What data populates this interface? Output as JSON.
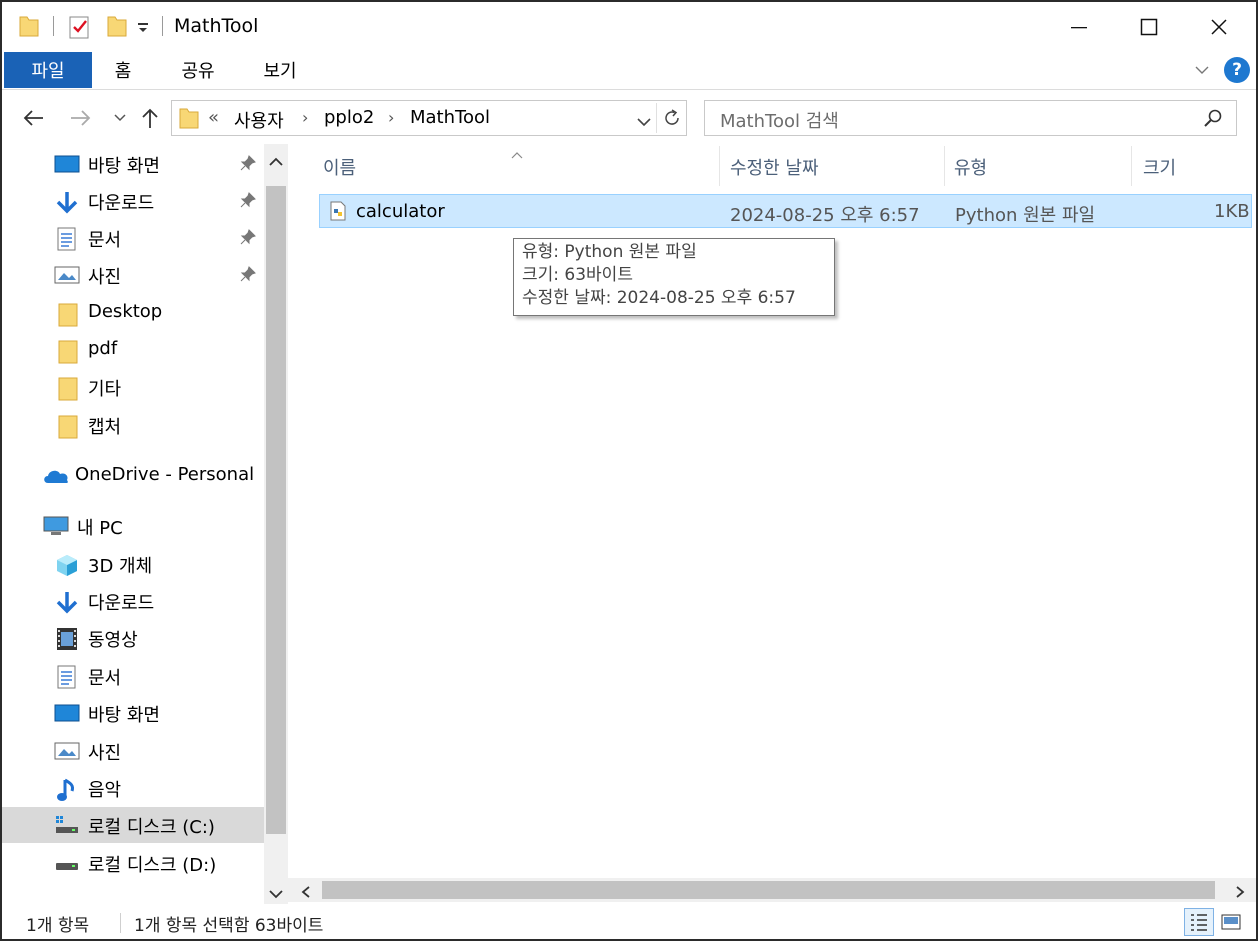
{
  "window": {
    "title": "MathTool",
    "minimize_glyph": "—",
    "close_glyph": "✕"
  },
  "ribbon": {
    "tabs": [
      "파일",
      "홈",
      "공유",
      "보기"
    ],
    "help_glyph": "?"
  },
  "address": {
    "prefix": "«",
    "crumbs": [
      "사용자",
      "pplo2",
      "MathTool"
    ]
  },
  "search": {
    "placeholder": "MathTool 검색"
  },
  "nav": {
    "quick_access": [
      {
        "label": "바탕 화면",
        "icon": "desktop-icon",
        "pinned": true
      },
      {
        "label": "다운로드",
        "icon": "download-icon",
        "pinned": true
      },
      {
        "label": "문서",
        "icon": "document-icon",
        "pinned": true
      },
      {
        "label": "사진",
        "icon": "picture-icon",
        "pinned": true
      },
      {
        "label": "Desktop",
        "icon": "folder-icon",
        "pinned": false
      },
      {
        "label": "pdf",
        "icon": "folder-icon",
        "pinned": false
      },
      {
        "label": "기타",
        "icon": "folder-icon",
        "pinned": false
      },
      {
        "label": "캡처",
        "icon": "folder-icon",
        "pinned": false
      }
    ],
    "onedrive": "OneDrive - Personal",
    "this_pc": "내 PC",
    "pc_items": [
      {
        "label": "3D 개체",
        "icon": "3d-objects-icon"
      },
      {
        "label": "다운로드",
        "icon": "download-icon"
      },
      {
        "label": "동영상",
        "icon": "video-icon"
      },
      {
        "label": "문서",
        "icon": "document-icon"
      },
      {
        "label": "바탕 화면",
        "icon": "desktop-icon"
      },
      {
        "label": "사진",
        "icon": "picture-icon"
      },
      {
        "label": "음악",
        "icon": "music-icon"
      },
      {
        "label": "로컬 디스크 (C:)",
        "icon": "system-drive-icon",
        "selected": true
      },
      {
        "label": "로컬 디스크 (D:)",
        "icon": "drive-icon"
      }
    ]
  },
  "columns": {
    "name": "이름",
    "date": "수정한 날짜",
    "type": "유형",
    "size": "크기"
  },
  "files": [
    {
      "name": "calculator",
      "date": "2024-08-25 오후 6:57",
      "type": "Python 원본 파일",
      "size": "1KB",
      "icon": "python-file-icon"
    }
  ],
  "tooltip": {
    "line1": "유형: Python 원본 파일",
    "line2": "크기: 63바이트",
    "line3": "수정한 날짜: 2024-08-25 오후 6:57"
  },
  "status": {
    "count": "1개 항목",
    "selection": "1개 항목 선택함 63바이트"
  },
  "colors": {
    "accent": "#1a62b6",
    "selection_bg": "#cce8ff",
    "selection_border": "#99d1ff",
    "folder": "#f8d775",
    "help": "#1e78d0"
  }
}
